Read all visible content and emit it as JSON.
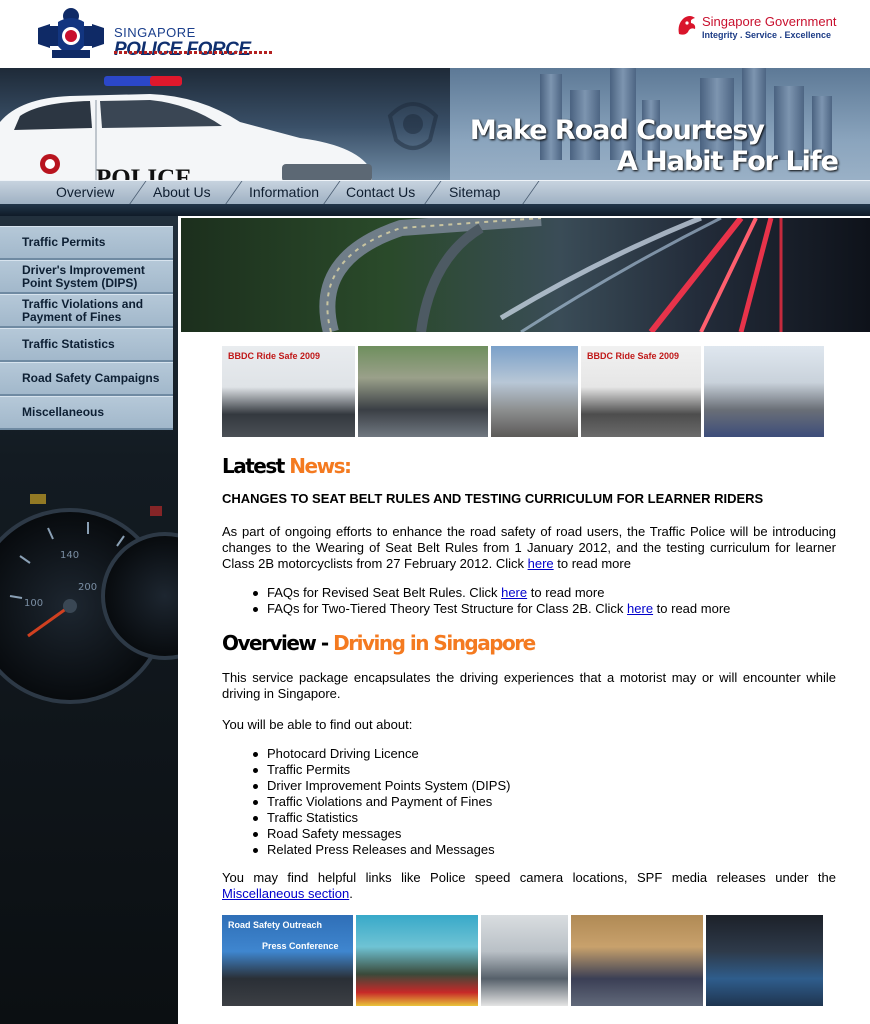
{
  "header": {
    "spf_line1": "SINGAPORE",
    "spf_line2": "POLICE FORCE",
    "gov_title_a": "Singapore",
    "gov_title_b": "Government",
    "gov_tagline": "Integrity . Service . Excellence"
  },
  "banner": {
    "car_label": "POLICE",
    "slogan_line1": "Make Road Courtesy",
    "slogan_line2": "A Habit For Life"
  },
  "nav": [
    "Overview",
    "About Us",
    "Information",
    "Contact Us",
    "Sitemap"
  ],
  "sidebar": {
    "items": [
      "Traffic Permits",
      "Driver's Improvement Point System (DIPS)",
      "Traffic Violations and Payment of Fines",
      "Traffic Statistics",
      "Road Safety Campaigns",
      "Miscellaneous"
    ]
  },
  "top_photos": {
    "caption_1": "BBDC Ride Safe 2009",
    "caption_4": "BBDC Ride Safe 2009"
  },
  "news": {
    "heading_black": "Latest ",
    "heading_orange": "News:",
    "title": "CHANGES TO SEAT BELT RULES AND TESTING CURRICULUM FOR LEARNER RIDERS",
    "body": "As part of ongoing efforts to enhance the road safety of road users, the Traffic Police will be introducing changes to the Wearing of Seat Belt Rules from 1 January 2012, and the testing curriculum for learner Class 2B motorcyclists from 27 February 2012. Click ",
    "body_link": "here",
    "body_end": " to read more",
    "faq1_pre": "FAQs for Revised Seat Belt Rules. Click ",
    "faq2_pre": "FAQs for Two-Tiered Theory Test Structure for Class 2B. Click ",
    "faq_link": "here",
    "faq_post": " to read more"
  },
  "overview": {
    "heading_black": "Overview - ",
    "heading_orange": "Driving in Singapore",
    "intro": "This service package encapsulates the driving experiences that a motorist may or will encounter while driving in Singapore.",
    "find_out": "You will be able to find out about:",
    "items": [
      "Photocard Driving Licence",
      "Traffic Permits",
      "Driver Improvement Points System (DIPS)",
      "Traffic Violations and Payment of Fines",
      "Traffic Statistics",
      "Road Safety messages",
      "Related Press Releases and Messages"
    ],
    "links_pre": "You may find helpful links like Police speed camera locations, SPF media releases under the ",
    "links_link": "Miscellaneous section",
    "links_post": "."
  },
  "bottom_photos": {
    "caption_1": "Road Safety Outreach",
    "caption_1b": "Press Conference"
  }
}
